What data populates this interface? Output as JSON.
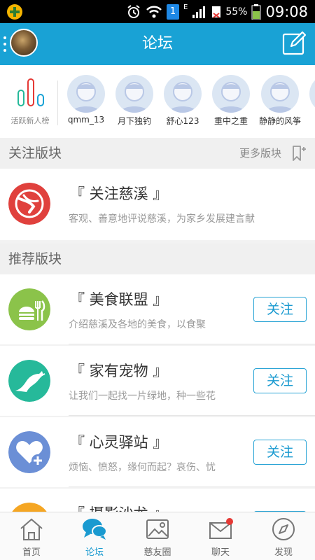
{
  "status_bar": {
    "battery": "55%",
    "time": "09:08",
    "sim_badge": "1",
    "network": "E"
  },
  "header": {
    "title": "论坛"
  },
  "active_users": {
    "ranking_label": "活跃新人榜",
    "users": [
      "qmm_13",
      "月下独钓",
      "舒心123",
      "重中之重",
      "静静的风筝"
    ]
  },
  "followed_section": {
    "title": "关注版块",
    "more_label": "更多版块"
  },
  "followed_forum": {
    "name": "『 关注慈溪 』",
    "desc": "客观、善意地评说慈溪，为家乡发展建言献"
  },
  "recommended_section": {
    "title": "推荐版块"
  },
  "recommended_forums": [
    {
      "name": "『 美食联盟 』",
      "desc": "介绍慈溪及各地的美食，以食聚",
      "button": "关注",
      "color": "#8bc34a",
      "icon": "food-icon"
    },
    {
      "name": "『 家有宠物 』",
      "desc": "让我们一起找一片绿地，种一些花",
      "button": "关注",
      "color": "#26b99a",
      "icon": "pet-icon"
    },
    {
      "name": "『 心灵驿站 』",
      "desc": "烦恼、愤怒，缘何而起？哀伤、忧",
      "button": "关注",
      "color": "#6b8fd6",
      "icon": "heart-icon"
    },
    {
      "name": "『 摄影沙龙 』",
      "desc": "",
      "button": "关注",
      "color": "#f5a623",
      "icon": "camera-icon"
    }
  ],
  "bottom_nav": [
    {
      "label": "首页",
      "icon": "home-icon",
      "active": false
    },
    {
      "label": "论坛",
      "icon": "chat-icon",
      "active": true
    },
    {
      "label": "慈友圈",
      "icon": "photo-icon",
      "active": false
    },
    {
      "label": "聊天",
      "icon": "mail-icon",
      "active": false
    },
    {
      "label": "发现",
      "icon": "compass-icon",
      "active": false
    }
  ],
  "colors": {
    "header": "#19a2d5",
    "accent": "#1a9ad0",
    "badge_red": "#e53935"
  }
}
